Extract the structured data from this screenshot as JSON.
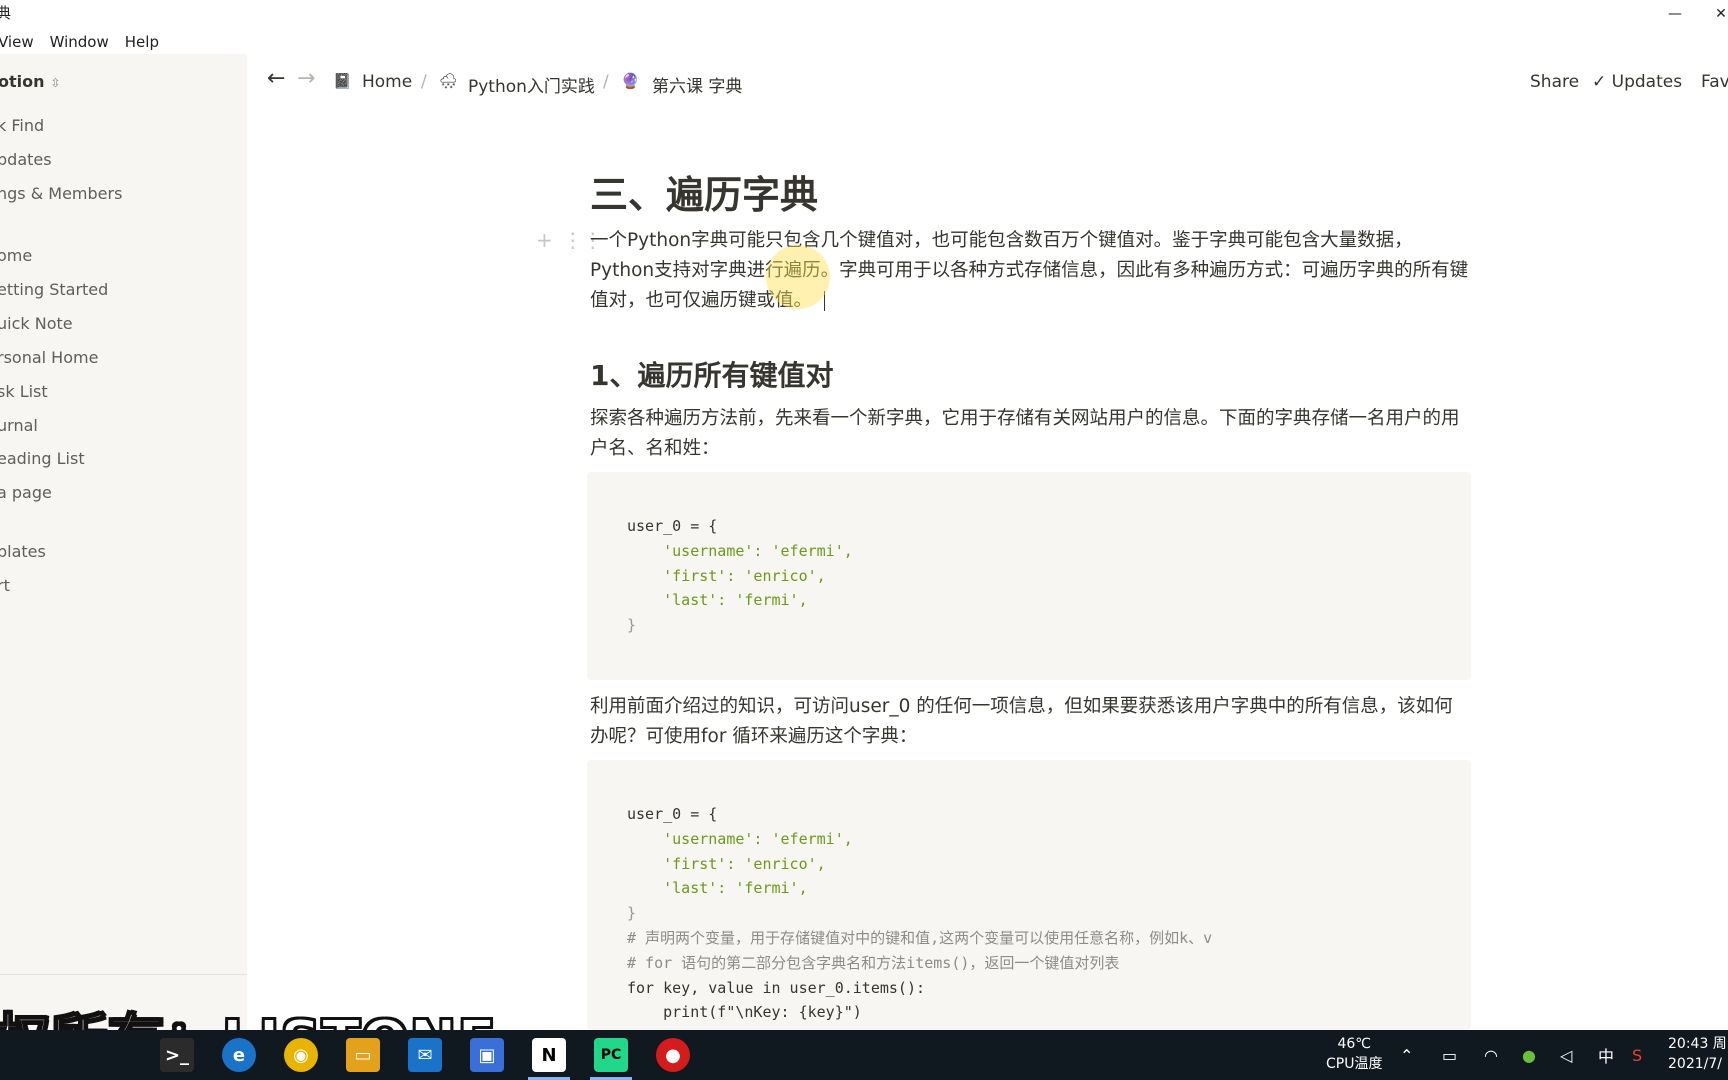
{
  "window": {
    "title_fragment": "典",
    "minimize_glyph": "—",
    "close_glyph": "✕"
  },
  "menu": [
    "View",
    "Window",
    "Help"
  ],
  "sidebar": {
    "workspace": "otion",
    "items": [
      {
        "label": "k Find"
      },
      {
        "label": "pdates"
      },
      {
        "label": "ngs & Members"
      },
      {
        "label": "ome"
      },
      {
        "label": "etting Started"
      },
      {
        "label": "uick Note"
      },
      {
        "label": "rsonal Home"
      },
      {
        "label": "sk List"
      },
      {
        "label": "urnal"
      },
      {
        "label": "eading List"
      },
      {
        "label": "a page"
      },
      {
        "label": "plates"
      },
      {
        "label": "rt"
      }
    ]
  },
  "topbar": {
    "breadcrumbs": [
      {
        "icon": "📓",
        "label": "Home"
      },
      {
        "icon": "🌨",
        "label": "Python入门实践"
      },
      {
        "icon": "🔮",
        "label": "第六课 字典"
      }
    ],
    "separator": "/",
    "share": "Share",
    "updates": "Updates",
    "favorite": "Fave"
  },
  "page": {
    "heading": "三、遍历字典",
    "intro": "一个Python字典可能只包含几个键值对，也可能包含数百万个键值对。鉴于字典可能包含大量数据，Python支持对字典进行遍历。字典可用于以各种方式存储信息，因此有多种遍历方式：可遍历字典的所有键值对，也可仅遍历键或值。",
    "subheading": "1、遍历所有键值对",
    "para1": "探索各种遍历方法前，先来看一个新字典，它用于存储有关网站用户的信息。下面的字典存储一名用户的用户名、名和姓：",
    "para2": "利用前面介绍过的知识，可访问user_0 的任何一项信息，但如果要获悉该用户字典中的所有信息，该如何办呢？可使用for 循环来遍历这个字典：",
    "code1": [
      "user_0 = {",
      "    'username': 'efermi',",
      "    'first': 'enrico',",
      "    'last': 'fermi',",
      "}"
    ],
    "code2": [
      "user_0 = {",
      "    'username': 'efermi',",
      "    'first': 'enrico',",
      "    'last': 'fermi',",
      "}",
      "# 声明两个变量，用于存储键值对中的键和值,这两个变量可以使用任意名称，例如k、v",
      "# for 语句的第二部分包含字典名和方法items()，返回一个键值对列表",
      "for key, value in user_0.items():",
      "    print(f\"\\nKey: {key}\")"
    ]
  },
  "overlay": {
    "subtitle": "权所有：LISTONE"
  },
  "taskbar": {
    "temp": "46℃",
    "temp_label": "CPU温度",
    "ime": "中",
    "time": "20:43 周",
    "date": "2021/7/"
  }
}
